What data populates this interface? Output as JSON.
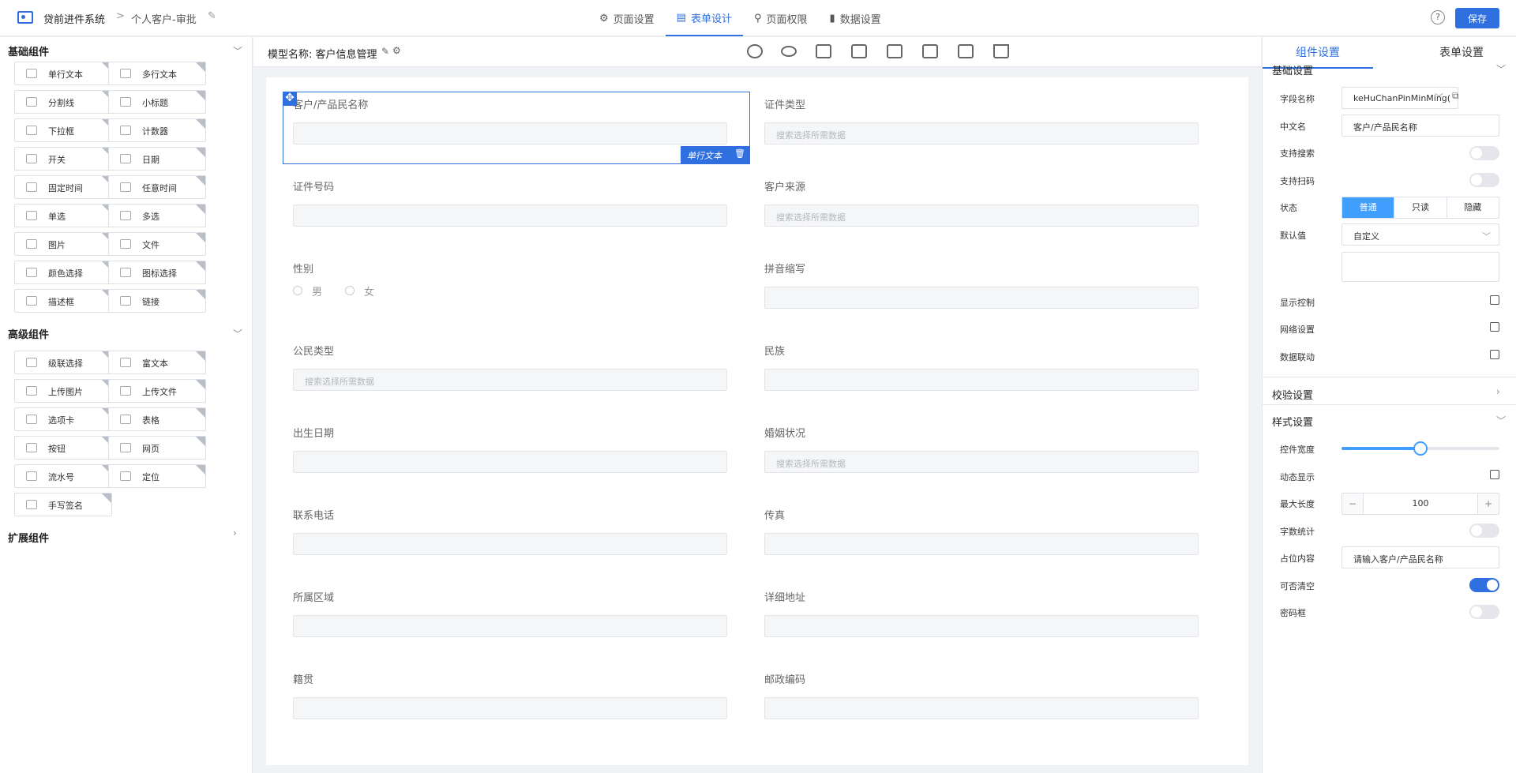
{
  "header": {
    "app_title": "贷前进件系统",
    "crumb_sep": ">",
    "crumb": "个人客户-审批",
    "tabs": [
      {
        "label": "页面设置",
        "icon": "gear-icon"
      },
      {
        "label": "表单设计",
        "icon": "document-icon"
      },
      {
        "label": "页面权限",
        "icon": "key-icon"
      },
      {
        "label": "数据设置",
        "icon": "bar-chart-icon"
      }
    ],
    "active_tab": "表单设计",
    "help": "?",
    "save_label": "保存"
  },
  "left": {
    "basic_title": "基础组件",
    "basic": [
      "单行文本",
      "多行文本",
      "分割线",
      "小标题",
      "下拉框",
      "计数器",
      "开关",
      "日期",
      "固定时间",
      "任意时间",
      "单选",
      "多选",
      "图片",
      "文件",
      "颜色选择",
      "图标选择",
      "描述框",
      "链接"
    ],
    "advanced_title": "高级组件",
    "advanced": [
      "级联选择",
      "富文本",
      "上传图片",
      "上传文件",
      "选项卡",
      "表格",
      "按钮",
      "网页",
      "流水号",
      "定位",
      "手写签名"
    ],
    "ext_title": "扩展组件"
  },
  "center": {
    "model_label": "模型名称: 客户信息管理",
    "selected_tag": "单行文本",
    "fields": [
      {
        "label": "客户/产品民名称",
        "placeholder": ""
      },
      {
        "label": "证件类型",
        "placeholder": "搜索选择所需数据"
      },
      {
        "label": "证件号码",
        "placeholder": ""
      },
      {
        "label": "客户来源",
        "placeholder": "搜索选择所需数据"
      },
      {
        "label": "性别",
        "placeholder": ""
      },
      {
        "label": "拼音缩写",
        "placeholder": ""
      },
      {
        "label": "公民类型",
        "placeholder": "搜索选择所需数据"
      },
      {
        "label": "民族",
        "placeholder": ""
      },
      {
        "label": "出生日期",
        "placeholder": ""
      },
      {
        "label": "婚姻状况",
        "placeholder": "搜索选择所需数据"
      },
      {
        "label": "联系电话",
        "placeholder": ""
      },
      {
        "label": "传真",
        "placeholder": ""
      },
      {
        "label": "所属区域",
        "placeholder": ""
      },
      {
        "label": "详细地址",
        "placeholder": ""
      },
      {
        "label": "籍贯",
        "placeholder": ""
      },
      {
        "label": "邮政编码",
        "placeholder": ""
      }
    ],
    "gender_options": [
      "男",
      "女"
    ]
  },
  "right": {
    "tab_component": "组件设置",
    "tab_form": "表单设置",
    "basic_section": "基础设置",
    "field_name_label": "字段名称",
    "field_name_value": "keHuChanPinMinMing(",
    "cn_name_label": "中文名",
    "cn_name_value": "客户/产品民名称",
    "support_search_label": "支持搜索",
    "support_scan_label": "支持扫码",
    "status_label": "状态",
    "status_options": [
      "普通",
      "只读",
      "隐藏"
    ],
    "status_selected": "普通",
    "default_label": "默认值",
    "default_value": "自定义",
    "display_ctrl_label": "显示控制",
    "grid_label": "网络设置",
    "data_link_label": "数据联动",
    "validate_section": "校验设置",
    "style_section": "样式设置",
    "width_label": "控件宽度",
    "width_value": 0.5,
    "dynamic_label": "动态显示",
    "maxlen_label": "最大长度",
    "maxlen_value": "100",
    "count_label": "字数统计",
    "placeholder_label": "占位内容",
    "placeholder_value": "请输入客户/产品民名称",
    "clearable_label": "可否清空",
    "clearable": true,
    "password_label": "密码框"
  }
}
